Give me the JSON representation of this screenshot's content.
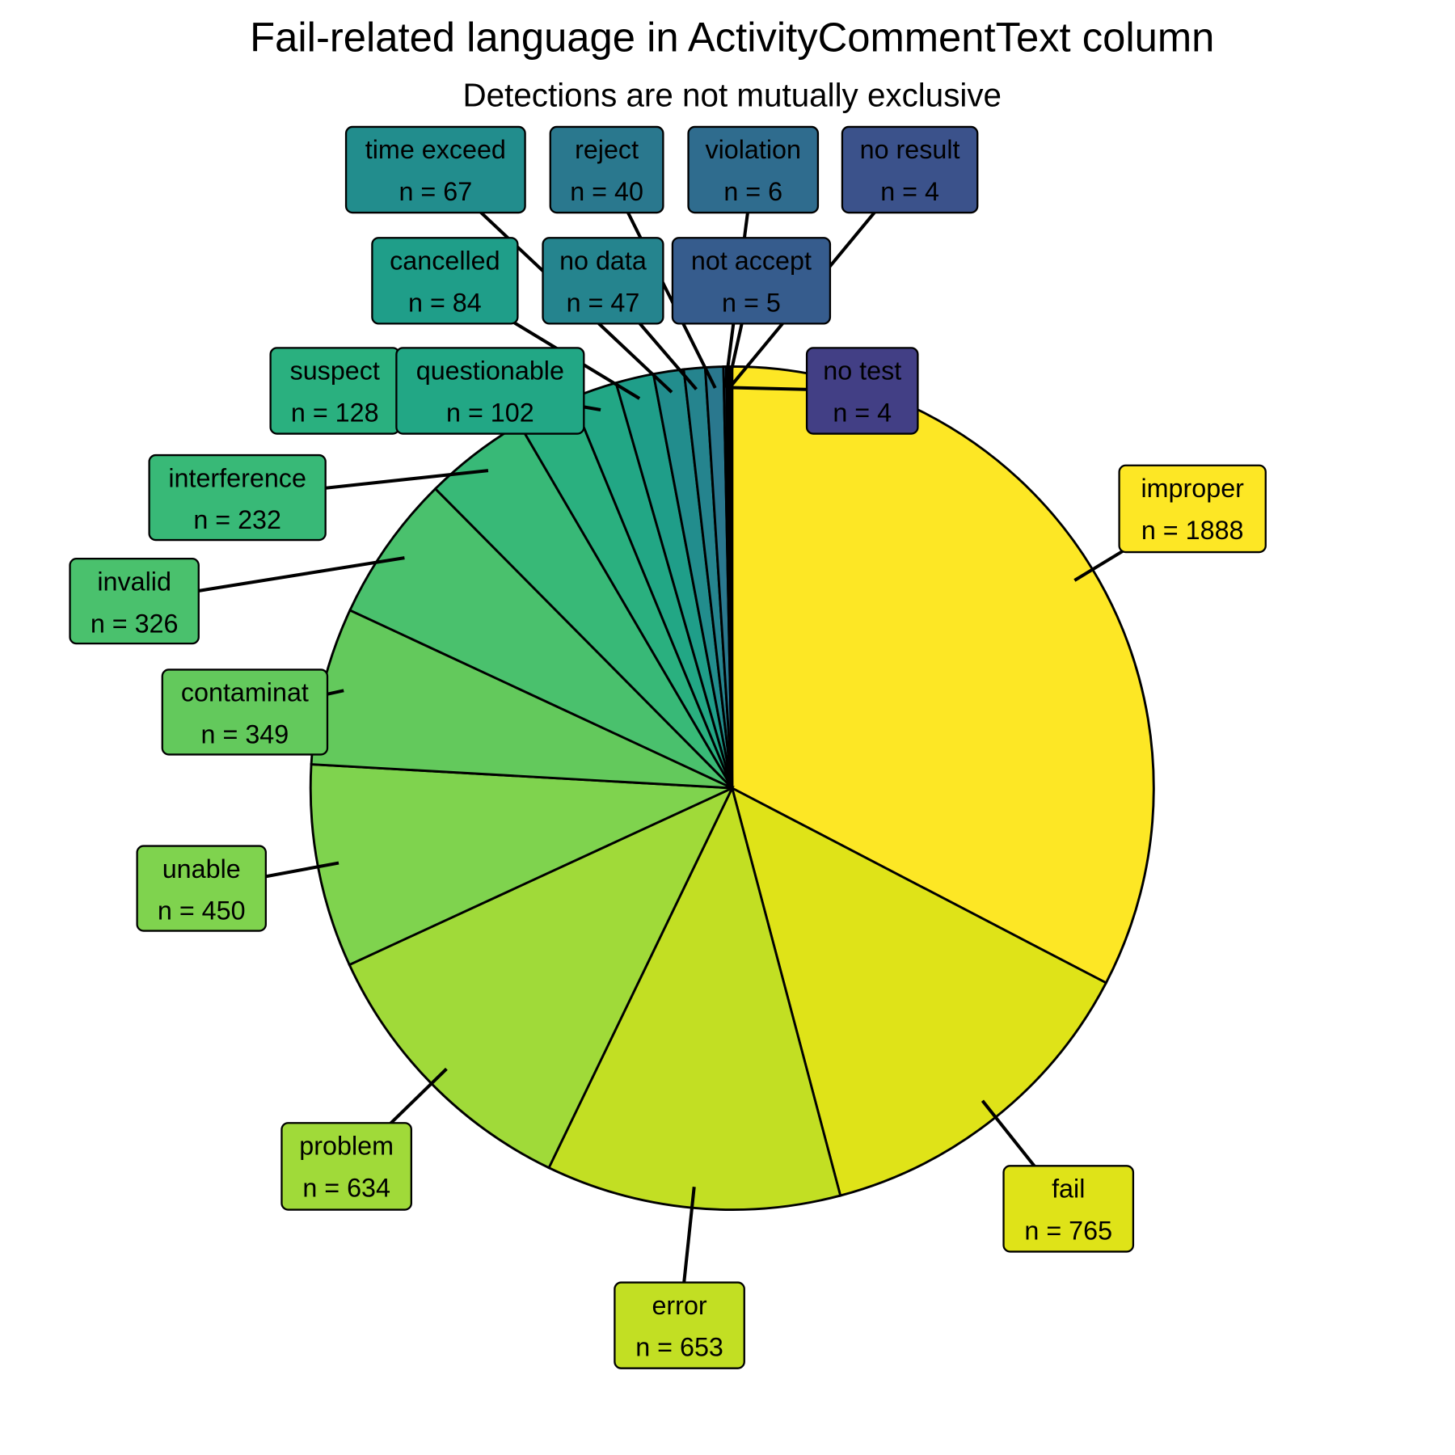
{
  "chart_data": {
    "type": "pie",
    "title": "Fail-related language in ActivityCommentText column",
    "subtitle": "Detections are not mutually exclusive",
    "label_prefix": "n = ",
    "direction": "clockwise from top",
    "palette": "viridis",
    "slices": [
      {
        "label": "improper",
        "value": 1888,
        "color": "#FDE725"
      },
      {
        "label": "fail",
        "value": 765,
        "color": "#DFE318"
      },
      {
        "label": "error",
        "value": 653,
        "color": "#C2DF23"
      },
      {
        "label": "problem",
        "value": 634,
        "color": "#A0DA39"
      },
      {
        "label": "unable",
        "value": 450,
        "color": "#7FD34E"
      },
      {
        "label": "contaminat",
        "value": 349,
        "color": "#63C95C"
      },
      {
        "label": "invalid",
        "value": 326,
        "color": "#4AC16D"
      },
      {
        "label": "interference",
        "value": 232,
        "color": "#38B977"
      },
      {
        "label": "suspect",
        "value": 128,
        "color": "#2AB07F"
      },
      {
        "label": "questionable",
        "value": 102,
        "color": "#22A785"
      },
      {
        "label": "cancelled",
        "value": 84,
        "color": "#1F9E89"
      },
      {
        "label": "time exceed",
        "value": 67,
        "color": "#228D8D"
      },
      {
        "label": "no data",
        "value": 47,
        "color": "#25848E"
      },
      {
        "label": "reject",
        "value": 40,
        "color": "#2A788E"
      },
      {
        "label": "violation",
        "value": 6,
        "color": "#2F6C8E"
      },
      {
        "label": "not accept",
        "value": 5,
        "color": "#365C8D"
      },
      {
        "label": "no result",
        "value": 4,
        "color": "#3B528B"
      },
      {
        "label": "no test",
        "value": 4,
        "color": "#423F85"
      }
    ]
  }
}
